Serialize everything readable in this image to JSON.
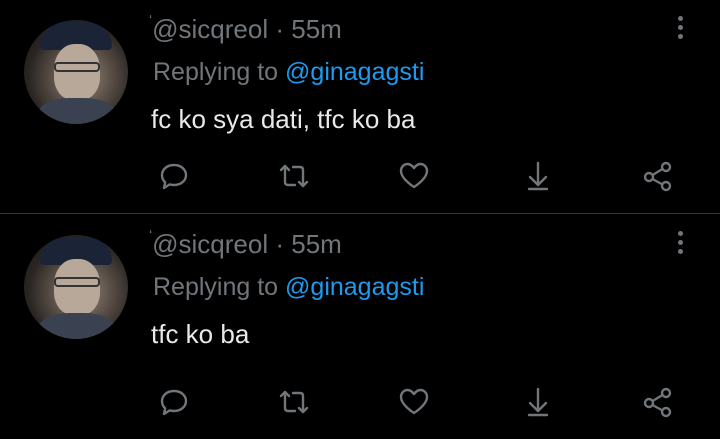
{
  "tweets": [
    {
      "handle": "@sicqreol",
      "separator": "·",
      "time": "55m",
      "replying_label": "Replying to",
      "replying_to": "@ginagagsti",
      "text": "fc ko sya dati, tfc ko ba"
    },
    {
      "handle": "@sicqreol",
      "separator": "·",
      "time": "55m",
      "replying_label": "Replying to",
      "replying_to": "@ginagagsti",
      "text": "tfc ko ba"
    }
  ],
  "icons": {
    "reply": "reply-icon",
    "retweet": "retweet-icon",
    "like": "heart-icon",
    "bookmark": "download-icon",
    "share": "share-icon",
    "more": "more-vertical-icon"
  },
  "colors": {
    "background": "#000000",
    "text": "#e7e9ea",
    "muted": "#71767b",
    "mention": "#1d9bf0",
    "divider": "#2f3336"
  }
}
